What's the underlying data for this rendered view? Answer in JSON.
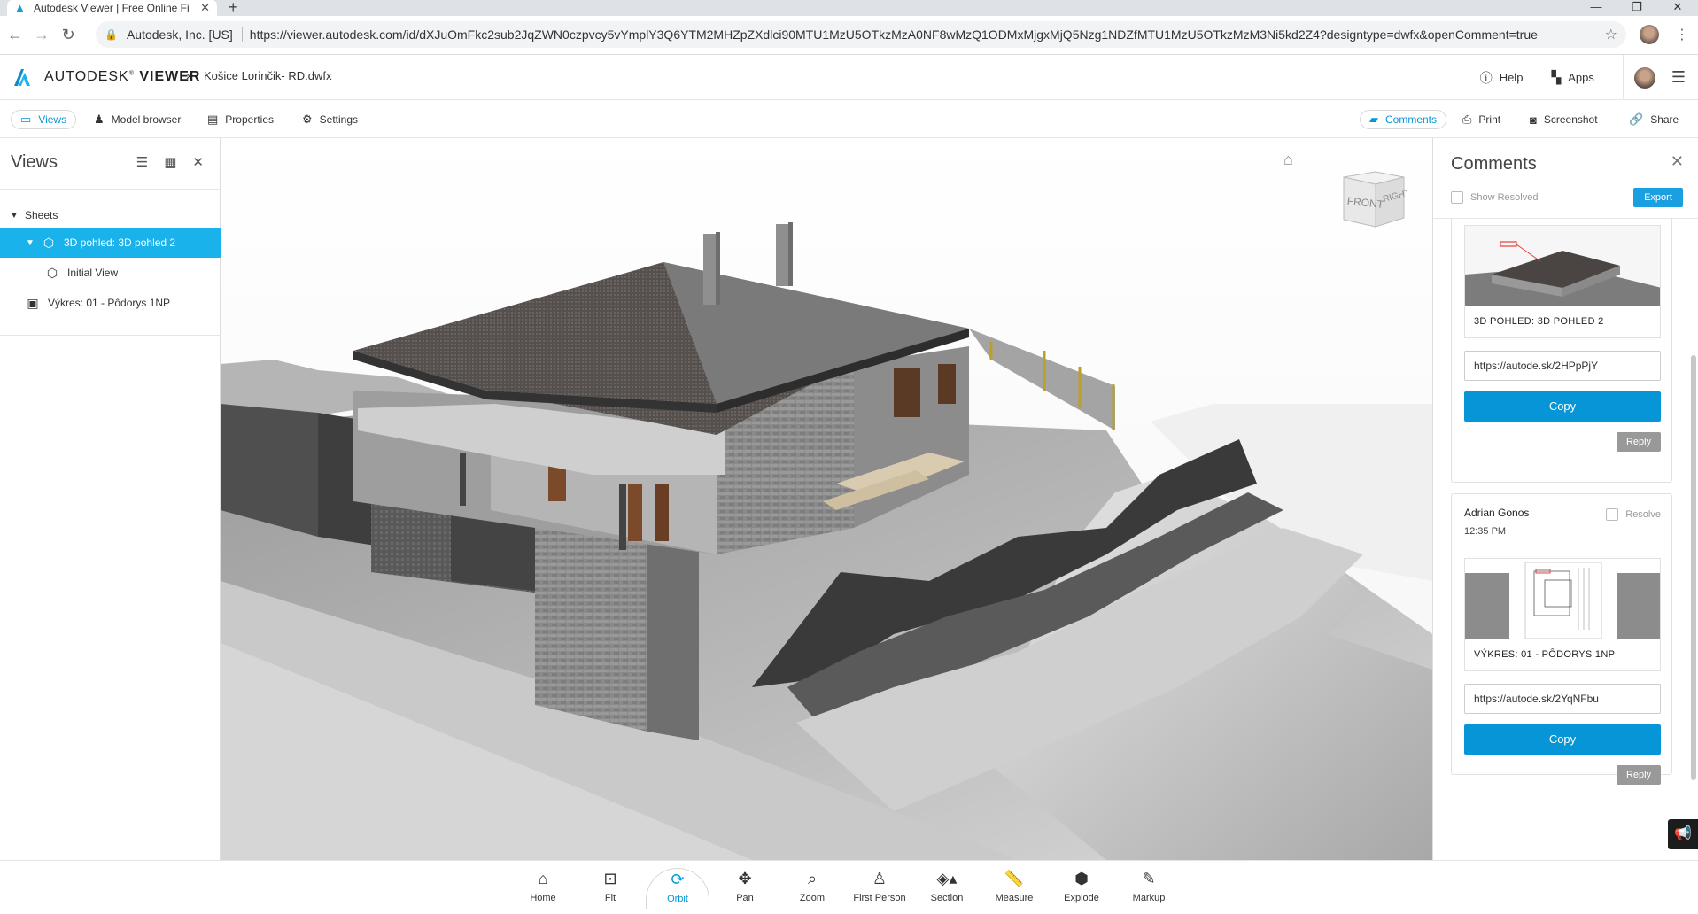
{
  "browser": {
    "tab_title": "Autodesk Viewer | Free Online Fi",
    "org": "Autodesk, Inc. [US]",
    "url": "https://viewer.autodesk.com/id/dXJuOmFkc2sub2JqZWN0czpvcy5vYmplY3Q6YTM2MHZpZXdlci90MTU1MzU5OTkzMzA0NF8wMzQ1ODMxMjgxMjQ5Nzg1NDZfMTU1MzU5OTkzMzM3Ni5kd2Z4?designtype=dwfx&openComment=true"
  },
  "app": {
    "brand_light": "AUTODESK",
    "brand_bold": "VIEWER",
    "filename": "Košice Lorinčik- RD.dwfx",
    "help_label": "Help",
    "apps_label": "Apps"
  },
  "toolbar": {
    "views": "Views",
    "model_browser": "Model browser",
    "properties": "Properties",
    "settings": "Settings",
    "comments": "Comments",
    "print": "Print",
    "screenshot": "Screenshot",
    "share": "Share"
  },
  "views_panel": {
    "title": "Views",
    "sheets_label": "Sheets",
    "items": [
      {
        "label": "3D pohled: 3D pohled 2"
      },
      {
        "label": "Initial View"
      },
      {
        "label": "Výkres: 01 - Pôdorys 1NP"
      }
    ]
  },
  "comments_panel": {
    "title": "Comments",
    "show_resolved": "Show Resolved",
    "export_label": "Export",
    "comments": [
      {
        "thumb_caption": "3D POHLED: 3D POHLED 2",
        "link": "https://autode.sk/2HPpPjY",
        "copy_label": "Copy",
        "reply_label": "Reply"
      },
      {
        "author": "Adrian Gonos",
        "time": "12:35 PM",
        "resolve_label": "Resolve",
        "thumb_caption": "VÝKRES: 01 - PÔDORYS 1NP",
        "link": "https://autode.sk/2YqNFbu",
        "copy_label": "Copy",
        "reply_label": "Reply"
      }
    ]
  },
  "viewcube": {
    "front": "FRONT",
    "right": "RIGHT"
  },
  "bottom_toolbar": {
    "home": "Home",
    "fit": "Fit",
    "orbit": "Orbit",
    "pan": "Pan",
    "zoom": "Zoom",
    "first_person": "First Person",
    "section": "Section",
    "measure": "Measure",
    "explode": "Explode",
    "markup": "Markup"
  },
  "colors": {
    "accent": "#0696d7",
    "selection": "#1ab2ea"
  }
}
